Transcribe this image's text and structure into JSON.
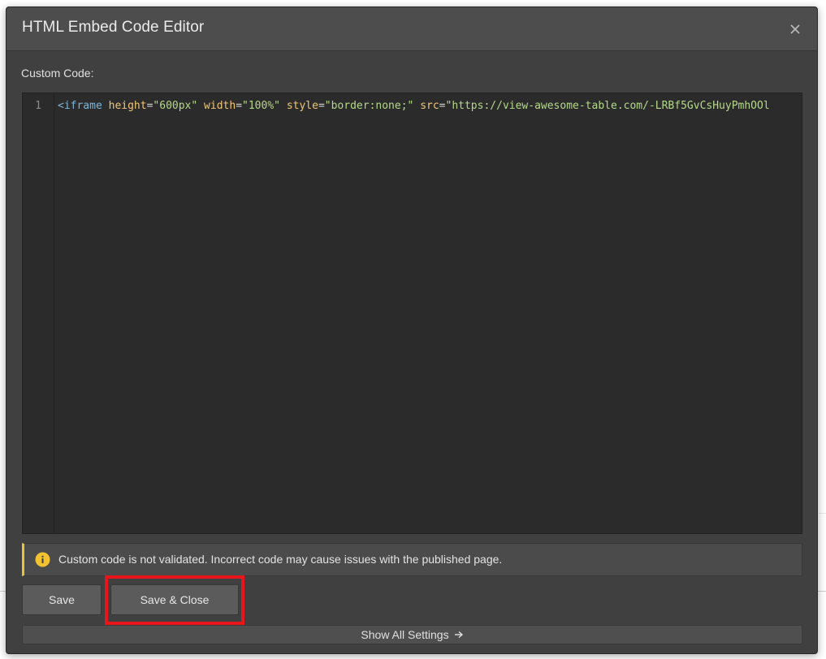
{
  "modal": {
    "title": "HTML Embed Code Editor"
  },
  "editor": {
    "label": "Custom Code:",
    "line_number": "1",
    "tokens": {
      "tag": "<iframe",
      "attr1": "height",
      "val1": "\"600px\"",
      "attr2": "width",
      "val2": "\"100%\"",
      "attr3": "style",
      "val3": "\"border:none;\"",
      "attr4": "src",
      "val4": "\"https://view-awesome-table.com/-LRBf5GvCsHuyPmhOOl"
    }
  },
  "warning": {
    "text": "Custom code is not validated. Incorrect code may cause issues with the published page.",
    "accent_color": "#e8c33a"
  },
  "buttons": {
    "save": "Save",
    "save_close": "Save & Close",
    "show_settings": "Show All Settings"
  },
  "highlight": {
    "color": "#e8161b"
  },
  "icons": {
    "close": "close-icon",
    "info": "info-icon",
    "arrow": "arrow-right-icon"
  }
}
